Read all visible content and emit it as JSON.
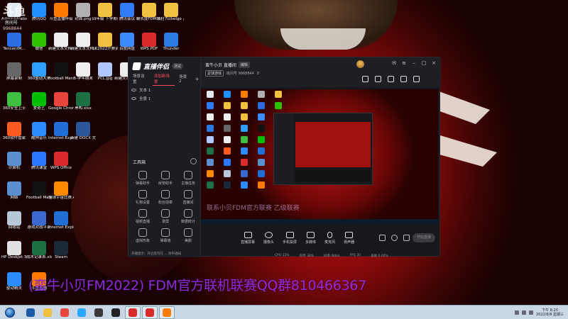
{
  "desktop": {
    "icons": [
      {
        "label": "Administrator",
        "color": "#dfe7ef"
      },
      {
        "label": "腾讯QQ",
        "color": "#1e90ff"
      },
      {
        "label": "斗鱼直播伴侣",
        "color": "#ff7a00"
      },
      {
        "label": "封面.png",
        "color": "#b0b0b0"
      },
      {
        "label": "四年级 下学期读书...",
        "color": "#f0c040"
      },
      {
        "label": "腾讯会议",
        "color": "#2f7cf6"
      },
      {
        "label": "翻长度FDM联赛 ...",
        "color": "#f0c040"
      },
      {
        "label": "6月7日kelgo 乙级联赛...",
        "color": "#f0c040"
      },
      {
        "label": "TencentM...",
        "color": "#2b6de0"
      },
      {
        "label": "微信",
        "color": "#2dc100"
      },
      {
        "label": "新建文本文档.txt",
        "color": "#eeeeee"
      },
      {
        "label": "新建文本文档 (2).txt",
        "color": "#eeeeee"
      },
      {
        "label": "SK2022开赛资料截图",
        "color": "#f0c040"
      },
      {
        "label": "百度网盘",
        "color": "#3a8cff"
      },
      {
        "label": "WPS PDF",
        "color": "#d92b2b"
      },
      {
        "label": "Thunder",
        "color": "#2a7be4"
      },
      {
        "label": "屏幕录制",
        "color": "#666666"
      },
      {
        "label": "360驱动大师",
        "color": "#2f9fff"
      },
      {
        "label": "Football Manag...",
        "color": "#111111"
      },
      {
        "label": "B-学年期末",
        "color": "#eeeeee"
      },
      {
        "label": "PCL.jpg",
        "color": "#b0c8ff"
      },
      {
        "label": "新建文本文档.txt",
        "color": "#eeeeee"
      },
      {
        "label": "360安全卫士",
        "color": "#3fbf3f"
      },
      {
        "label": "爱奇艺",
        "color": "#00be06"
      },
      {
        "label": "Google Chrome",
        "color": "#e8453c"
      },
      {
        "label": "黑鸭.xlsx",
        "color": "#1d7044"
      },
      {
        "label": "360软件管家",
        "color": "#ff5a1f"
      },
      {
        "label": "酷狗音乐",
        "color": "#2a8cff"
      },
      {
        "label": "Internet Explorer",
        "color": "#1f6fd6"
      },
      {
        "label": "新建 DOCX 文档.docx",
        "color": "#2b579a"
      },
      {
        "label": "计算机",
        "color": "#5a8fd0"
      },
      {
        "label": "腾讯课堂",
        "color": "#2a78ff"
      },
      {
        "label": "WPS Office",
        "color": "#d92b2b"
      },
      {
        "label": "网络",
        "color": "#5a8fd0"
      },
      {
        "label": "Football Manager ...",
        "color": "#111111"
      },
      {
        "label": "懂球宇宙比赛.exe",
        "color": "#ff8a00"
      },
      {
        "label": "回收站",
        "color": "#b8c8d8"
      },
      {
        "label": "游戏对战平台",
        "color": "#3a6ad0"
      },
      {
        "label": "Internet Explorer",
        "color": "#1f6fd6"
      },
      {
        "label": "HP DeskJet 3630 series",
        "color": "#e0e0e0"
      },
      {
        "label": "战术记录表.xlsx",
        "color": "#1d7044"
      },
      {
        "label": "Steam",
        "color": "#1b2838"
      },
      {
        "label": "驱动精灵",
        "color": "#2a8cff"
      },
      {
        "label": "斗鱼直播",
        "color": "#ff7a00"
      }
    ]
  },
  "watermark": {
    "logo": "斗鱼",
    "label": "房间号",
    "room_id": "9968844"
  },
  "app": {
    "logo_text": "直播伴侣",
    "logo_badge": "测试",
    "scene_tabs": [
      "场景设置",
      "添加新场景",
      "场景 2"
    ],
    "sources": [
      "文本 1",
      "全景 1"
    ],
    "toolbox_title": "工具箱",
    "tools": [
      "弹幕助手",
      "房管助手",
      "主播任务",
      "礼物设置",
      "粉丝勋章",
      "直播间",
      "视频直播",
      "录屏",
      "数据统计",
      "虚拟形象",
      "弹幕墙",
      "美颜"
    ],
    "sidebar_notice": "开播提示：开启后可在 ... 附带通知",
    "channel_title": "蛮牛小贝 直播间",
    "edit_badge": "编辑",
    "category": "足球游戏",
    "room_meta": "房间号 9968844",
    "hot": "0",
    "controls": [
      "直播屏幕",
      "摄像头",
      "手机投屏",
      "多媒体",
      "麦克风",
      "扬声器"
    ],
    "start_live": "开始直播",
    "status": [
      "CPU 12%",
      "内存 38%",
      "码率 0kb/s",
      "FPS 30",
      "丢帧 0.00%"
    ]
  },
  "preview": {
    "overlay_text": "联系小贝FDM官方联赛 乙级联赛"
  },
  "caption": "(蛮牛小贝FM2022) FDM官方联机联赛QQ群810466367",
  "taskbar": {
    "apps": [
      {
        "name": "start",
        "color": "#1a5aa8"
      },
      {
        "name": "files",
        "color": "#f0c040"
      },
      {
        "name": "chrome",
        "color": "#e8453c"
      },
      {
        "name": "media",
        "color": "#2aa8ff"
      },
      {
        "name": "pot",
        "color": "#3a3a3a"
      },
      {
        "name": "22",
        "color": "#222222"
      },
      {
        "name": "app7",
        "color": "#d92b2b"
      },
      {
        "name": "wps",
        "color": "#d92b2b"
      },
      {
        "name": "douyu",
        "color": "#ff7a00"
      }
    ],
    "time": "下午 8:20",
    "date": "2022/6/8 星期三"
  }
}
